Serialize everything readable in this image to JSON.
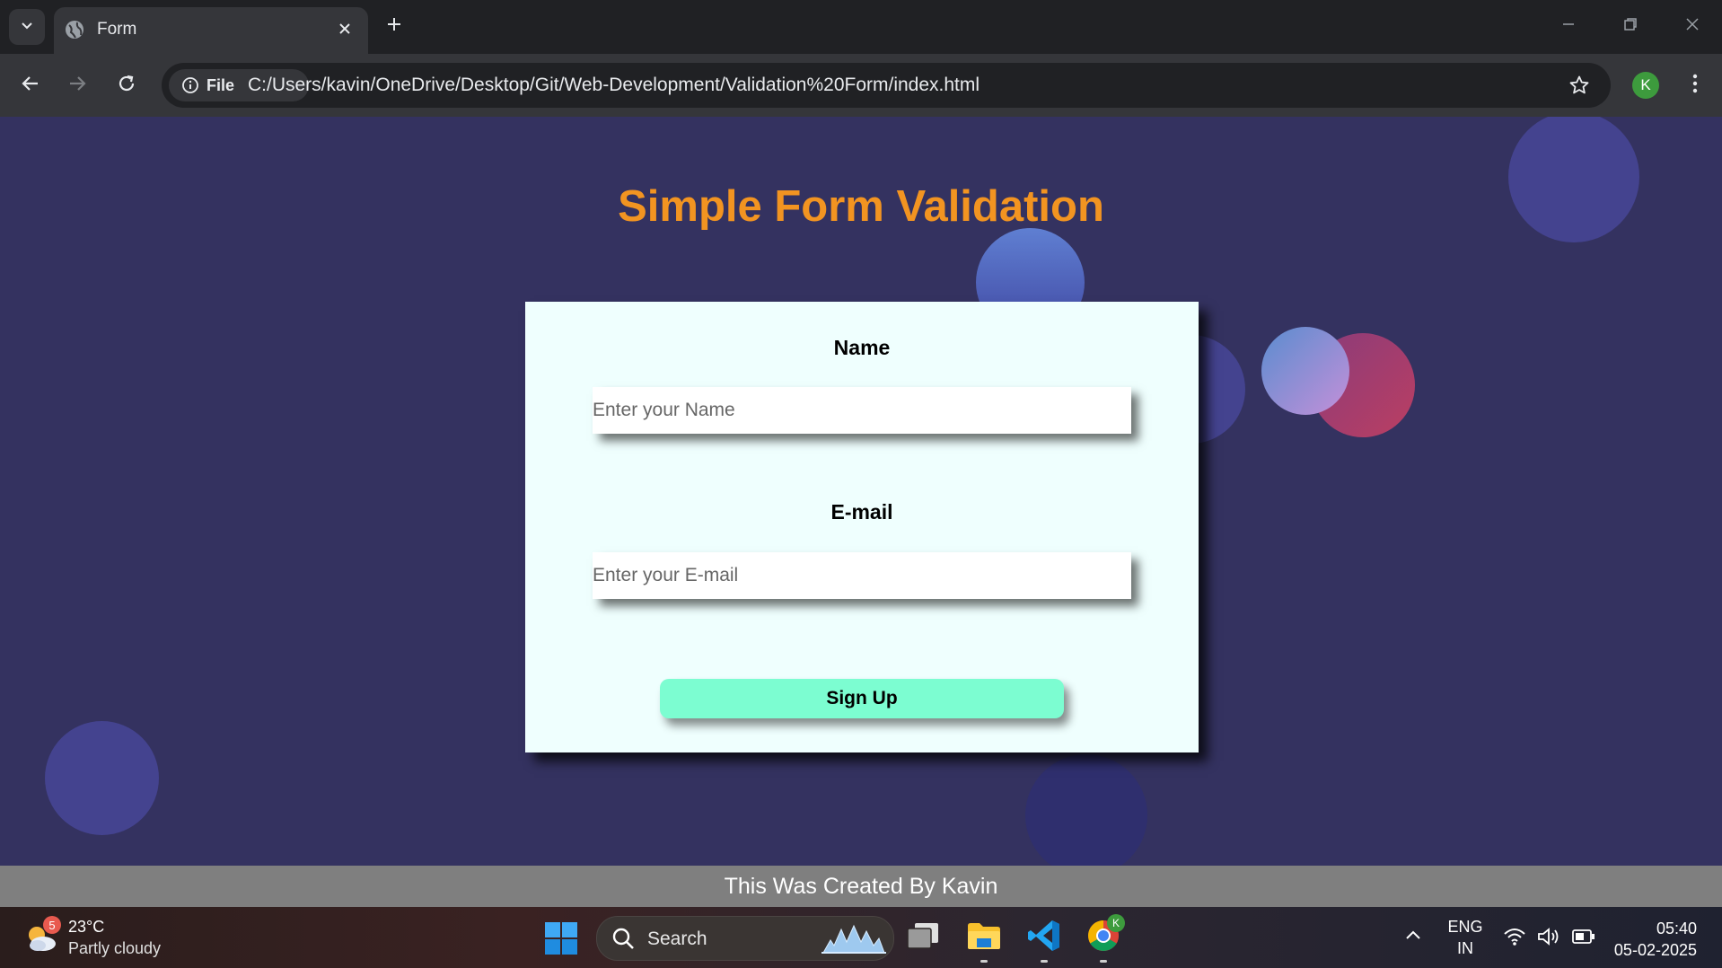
{
  "browser": {
    "tab_title": "Form",
    "file_chip_label": "File",
    "url": "C:/Users/kavin/OneDrive/Desktop/Git/Web-Development/Validation%20Form/index.html",
    "profile_initial": "K"
  },
  "page": {
    "title": "Simple Form Validation",
    "name_label": "Name",
    "name_placeholder": "Enter your Name",
    "email_label": "E-mail",
    "email_placeholder": "Enter your E-mail",
    "signup_label": "Sign Up",
    "footer_text": "This Was Created By Kavin"
  },
  "taskbar": {
    "weather_badge": "5",
    "weather_temp": "23°C",
    "weather_desc": "Partly cloudy",
    "search_label": "Search",
    "language_line1": "ENG",
    "language_line2": "IN",
    "time": "05:40",
    "date": "05-02-2025",
    "chrome_badge": "K"
  },
  "colors": {
    "page_background": "#343260",
    "title_orange": "#f29421",
    "card_background": "#effffe",
    "signup_button": "#7cfdd1",
    "footer_background": "#7f7f7f"
  }
}
